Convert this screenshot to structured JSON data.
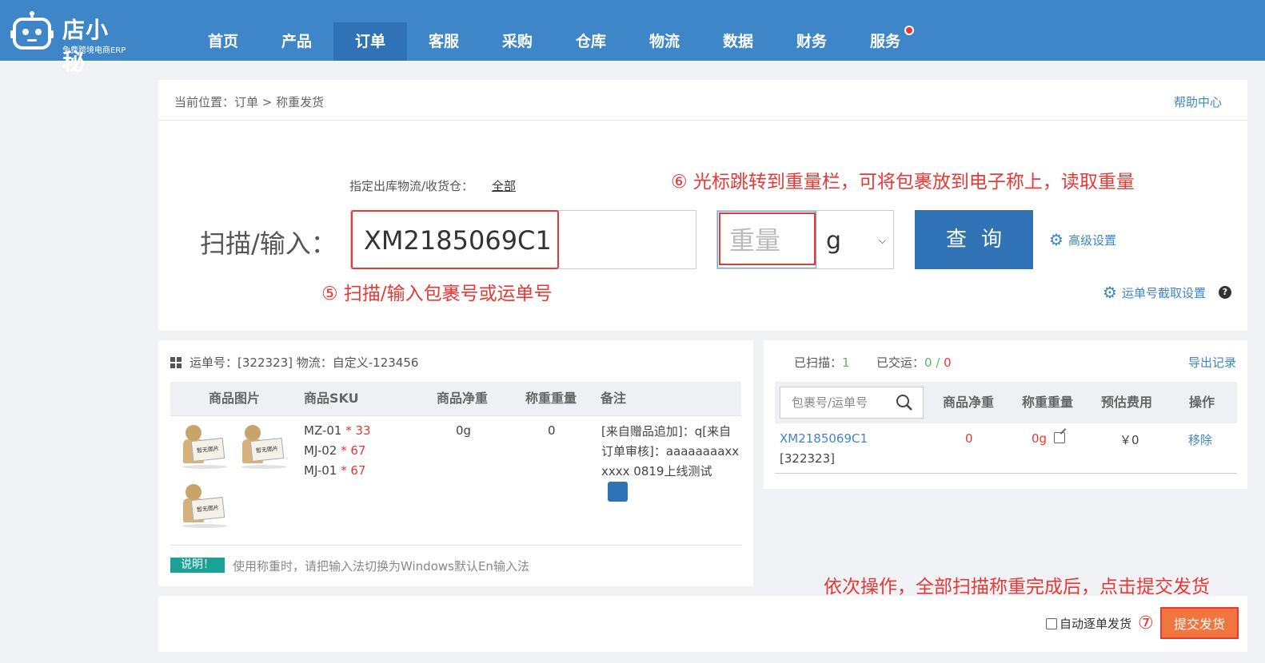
{
  "logo": {
    "name": "店小秘",
    "subtitle": "免费跨境电商ERP"
  },
  "nav": [
    {
      "label": "首页"
    },
    {
      "label": "产品"
    },
    {
      "label": "订单",
      "active": true
    },
    {
      "label": "客服"
    },
    {
      "label": "采购"
    },
    {
      "label": "仓库"
    },
    {
      "label": "物流"
    },
    {
      "label": "数据"
    },
    {
      "label": "财务"
    },
    {
      "label": "服务"
    }
  ],
  "breadcrumb": "当前位置：订单 > 称重发货",
  "help_link": "帮助中心",
  "scan": {
    "warehouse_label": "指定出库物流/收货仓：",
    "warehouse_value": "全部",
    "label": "扫描/输入：",
    "value": "XM2185069C1",
    "weight_placeholder": "重量",
    "unit": "g",
    "query_label": "查询",
    "adv_setting": "高级设置",
    "waybill_setting": "运单号截取设置"
  },
  "annotations": {
    "step6": "⑥ 光标跳转到重量栏，可将包裹放到电子称上，读取重量",
    "step5": "⑤  扫描/输入包裹号或运单号",
    "step7_text": "依次操作，全部扫描称重完成后，点击提交发货",
    "step7_num": "⑦"
  },
  "order": {
    "header": "运单号：[322323]  物流：自定义-123456",
    "columns": [
      "商品图片",
      "商品SKU",
      "商品净重",
      "称重重量",
      "备注"
    ],
    "image_caption": "暂无图片",
    "skus": [
      {
        "sku": "MZ-01",
        "qty": "* 33"
      },
      {
        "sku": "MJ-02",
        "qty": "* 67"
      },
      {
        "sku": "MJ-01",
        "qty": "* 67"
      }
    ],
    "net_weight": "0g",
    "weighed": "0",
    "remark": "[来自赠品追加]：q[来自订单审核]：aaaaaaaaxxxxxx 0819上线测试",
    "note_badge": "说明！",
    "note_text": "使用称重时，请把输入法切换为Windows默认En输入法"
  },
  "summary": {
    "scanned_label": "已扫描：",
    "scanned_value": "1",
    "delivered_label": "已交运：",
    "delivered_value": "0",
    "delivered_sep": " / ",
    "delivered_total": "0",
    "export": "导出记录",
    "search_placeholder": "包裹号/运单号",
    "columns": [
      "商品净重",
      "称重重量",
      "预估费用",
      "操作"
    ],
    "row": {
      "package": "XM2185069C1",
      "waybill": "[322323]",
      "net": "0",
      "weighed": "0g",
      "fee": "￥0",
      "action": "移除"
    }
  },
  "footer": {
    "auto_label": "自动逐单发货",
    "submit": "提交发货"
  },
  "colors": {
    "brand": "#3e86c8",
    "nav_active": "#2f73b6",
    "annotation": "#e53935",
    "submit": "#f0753f"
  }
}
